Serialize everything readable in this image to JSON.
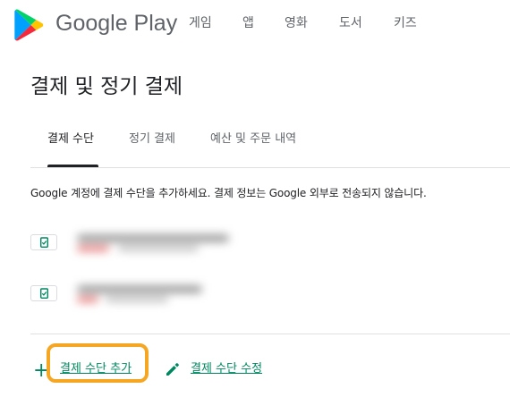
{
  "header": {
    "app_name": "Google Play",
    "nav": [
      "게임",
      "앱",
      "영화",
      "도서",
      "키즈"
    ]
  },
  "page_title": "결제 및 정기 결제",
  "tabs": [
    {
      "label": "결제 수단",
      "active": true
    },
    {
      "label": "정기 결제",
      "active": false
    },
    {
      "label": "예산 및 주문 내역",
      "active": false
    }
  ],
  "info_text": "Google 계정에 결제 수단을 추가하세요. 결제 정보는 Google 외부로 전송되지 않습니다.",
  "payment_methods": [
    {
      "icon": "card-check-icon"
    },
    {
      "icon": "card-check-icon"
    }
  ],
  "actions": {
    "add_label": "결제 수단 추가",
    "edit_label": "결제 수단 수정"
  },
  "colors": {
    "accent": "#01875f",
    "highlight": "#f5a623",
    "text": "#202124",
    "muted": "#5f6368"
  }
}
